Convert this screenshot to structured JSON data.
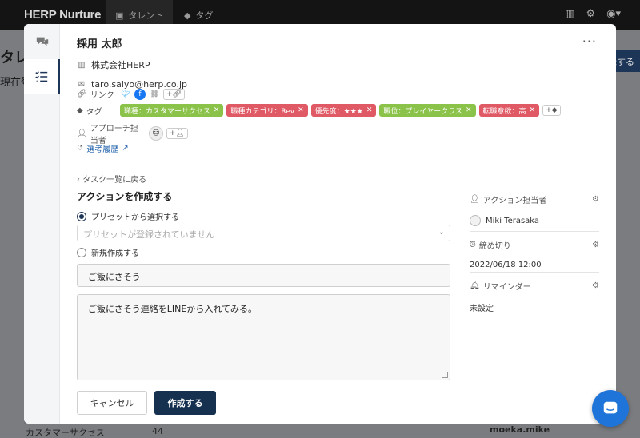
{
  "app": {
    "logo": "HERP Nurture",
    "nav": [
      {
        "label": "タレント"
      },
      {
        "label": "タグ"
      }
    ],
    "bg_title": "タレ",
    "bg_sub": "現在登",
    "bg_button": "録する",
    "bg_row_text": "カスタマーサクセス",
    "bg_row_count": "44",
    "bg_name": "moeka.mike"
  },
  "candidate": {
    "name": "採用 太郎",
    "company": "株式会社HERP",
    "email": "taro.saiyo@herp.co.jp"
  },
  "meta": {
    "link_label": "リンク",
    "tag_label": "タグ",
    "approach_label": "アプローチ担当者",
    "history_label": "選考履歴",
    "tags": [
      {
        "label": "職種：カスタマーサクセス",
        "color": "#8bc34a"
      },
      {
        "label": "職種カテゴリ：Rev",
        "color": "#e05a66"
      },
      {
        "label": "優先度：★★★",
        "color": "#e05a66"
      },
      {
        "label": "職位：プレイヤークラス",
        "color": "#8bc34a"
      },
      {
        "label": "転職意欲：高",
        "color": "#e05a66"
      }
    ]
  },
  "form": {
    "back_label": "タスク一覧に戻る",
    "section_title": "アクションを作成する",
    "preset_option": "プリセットから選択する",
    "preset_placeholder": "プリセットが登録されていません",
    "new_option": "新規作成する",
    "title_value": "ご飯にさそう",
    "body_value": "ご飯にさそう連絡をLINEから入れてみる。",
    "cancel_label": "キャンセル",
    "create_label": "作成する"
  },
  "right_panel": {
    "assignee_label": "アクション担当者",
    "assignee_value": "Miki Terasaka",
    "deadline_label": "締め切り",
    "deadline_value": "2022/06/18 12:00",
    "reminder_label": "リマインダー",
    "reminder_value": "未設定"
  }
}
